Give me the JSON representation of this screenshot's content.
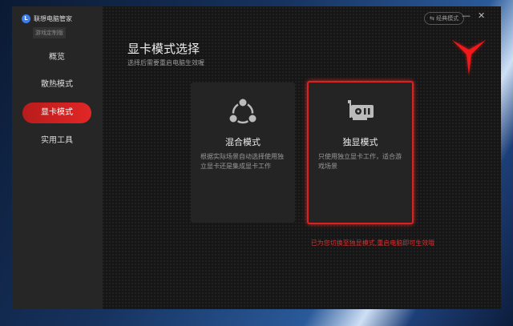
{
  "app": {
    "name": "联想电脑管家",
    "edition": "游戏定制版"
  },
  "sidebar": {
    "items": [
      {
        "label": "概览"
      },
      {
        "label": "散热模式"
      },
      {
        "label": "显卡模式",
        "active": true
      },
      {
        "label": "实用工具"
      }
    ]
  },
  "header": {
    "classic_mode": "经典模式"
  },
  "main": {
    "title": "显卡模式选择",
    "subtitle": "选择后需要重启电脑生效喔",
    "cards": [
      {
        "title": "混合模式",
        "desc": "根据实际场景自动选择使用独立显卡还是集成显卡工作",
        "icon": "share-nodes-icon"
      },
      {
        "title": "独显模式",
        "desc": "只使用独立显卡工作，适合游戏场景",
        "icon": "graphics-card-icon",
        "selected": true
      }
    ],
    "notice": "已为您切换至独显模式,重启电脑即可生效哦"
  },
  "colors": {
    "accent": "#e22626"
  }
}
